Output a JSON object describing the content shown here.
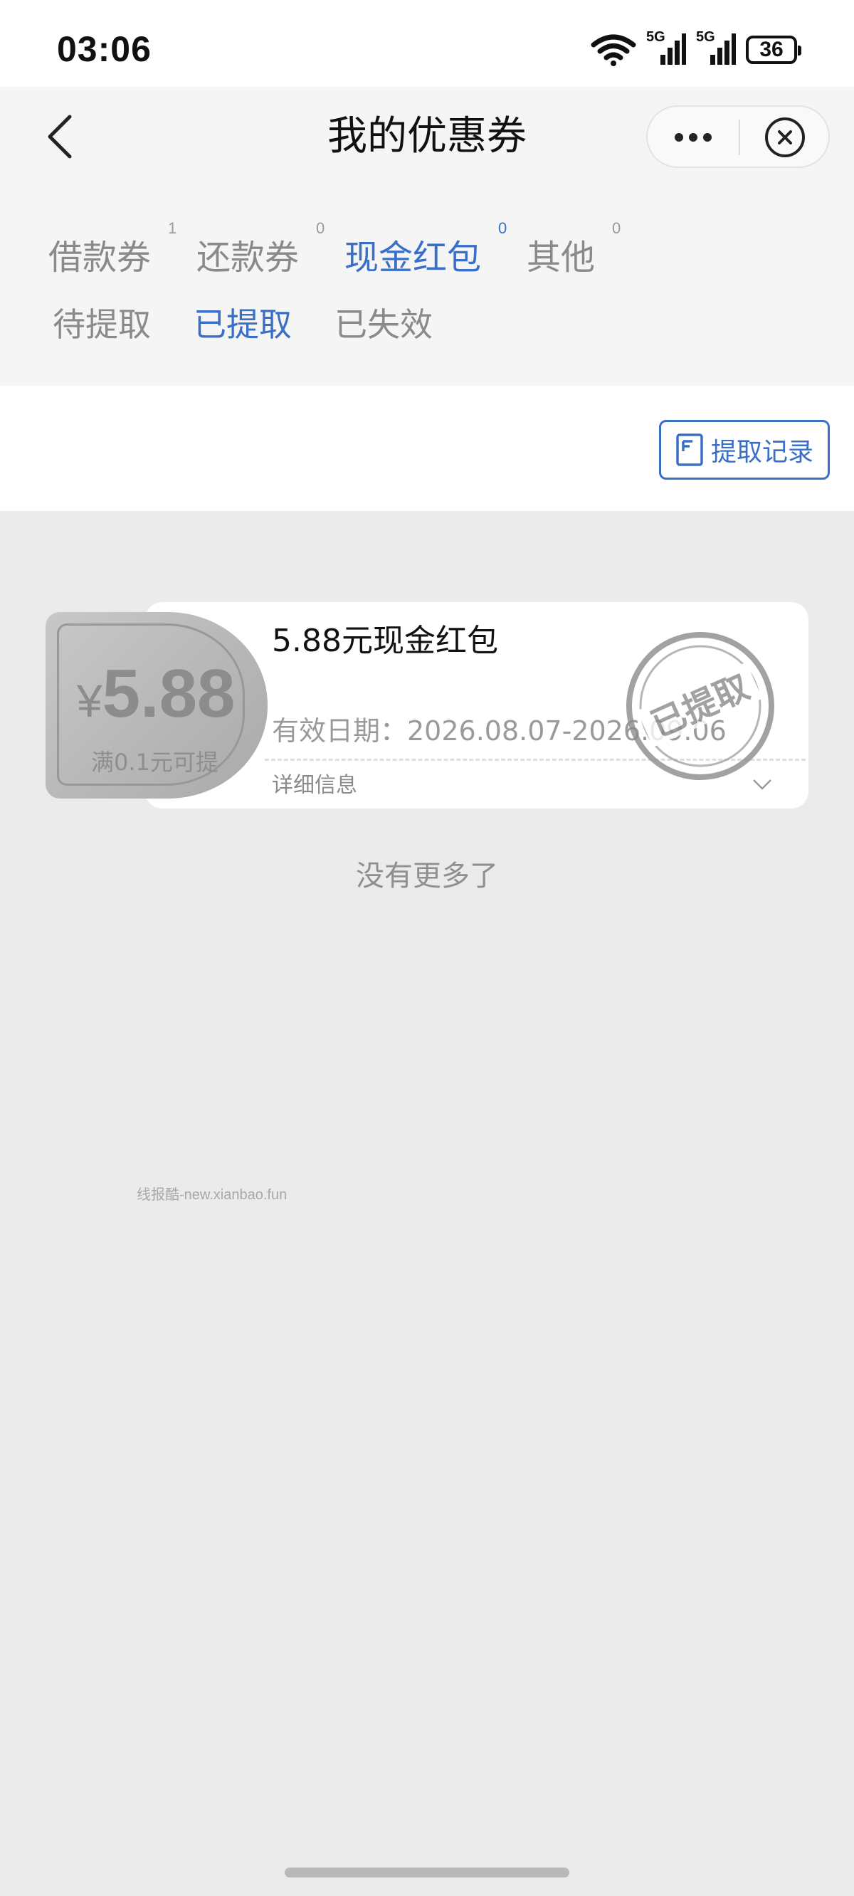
{
  "status_bar": {
    "time": "03:06",
    "battery": "36",
    "signal_1_tag": "5G",
    "signal_2_tag": "5G",
    "icons": [
      "wifi-icon",
      "signal-5g-icon",
      "signal-5g-icon",
      "battery-icon"
    ]
  },
  "header": {
    "title": "我的优惠券",
    "back_icon": "chevron-left-icon",
    "more_icon": "more-dots-icon",
    "close_icon": "close-circle-icon"
  },
  "tabs": [
    {
      "label": "借款券",
      "count": "1",
      "active": false
    },
    {
      "label": "还款券",
      "count": "0",
      "active": false
    },
    {
      "label": "现金红包",
      "count": "0",
      "active": true
    },
    {
      "label": "其他",
      "count": "0",
      "active": false
    }
  ],
  "subtabs": [
    {
      "label": "待提取",
      "active": false
    },
    {
      "label": "已提取",
      "active": true
    },
    {
      "label": "已失效",
      "active": false
    }
  ],
  "toolbar": {
    "record_label": "提取记录",
    "record_icon": "document-icon"
  },
  "coupon": {
    "currency": "¥",
    "amount": "5.88",
    "condition": "满0.1元可提",
    "title": "5.88元现金红包",
    "validity": "有效日期：2026.08.07-2026.09.06",
    "detail_label": "详细信息",
    "stamp_text": "已提取"
  },
  "no_more_text": "没有更多了",
  "watermark": "线报酷-new.xianbao.fun",
  "colors": {
    "accent": "#3a6fc8",
    "background": "#ebebeb",
    "inactive_text": "#8a8a8a"
  }
}
